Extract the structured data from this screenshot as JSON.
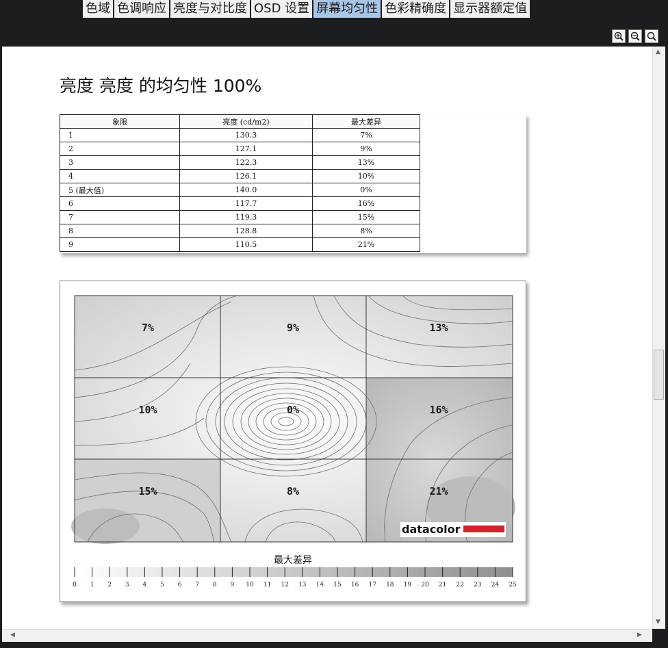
{
  "tabs": [
    {
      "label": "色域"
    },
    {
      "label": "色调响应"
    },
    {
      "label": "亮度与对比度"
    },
    {
      "label": "OSD 设置"
    },
    {
      "label": "屏幕均匀性",
      "active": true
    },
    {
      "label": "色彩精确度"
    },
    {
      "label": "显示器额定值"
    }
  ],
  "toolbar": {
    "zoom_in_icon": "zoom-in-icon",
    "zoom_out_icon": "zoom-out-icon",
    "zoom_fit_icon": "zoom-fit-icon"
  },
  "report": {
    "title": "亮度 亮度 的均匀性 100%",
    "table": {
      "headers": [
        "象限",
        "亮度 (cd/m2)",
        "最大差异"
      ],
      "rows": [
        [
          "1",
          "130.3",
          "7%"
        ],
        [
          "2",
          "127.1",
          "9%"
        ],
        [
          "3",
          "122.3",
          "13%"
        ],
        [
          "4",
          "126.1",
          "10%"
        ],
        [
          "5 (最大值)",
          "140.0",
          "0%"
        ],
        [
          "6",
          "117.7",
          "16%"
        ],
        [
          "7",
          "119.3",
          "15%"
        ],
        [
          "8",
          "128.8",
          "8%"
        ],
        [
          "9",
          "110.5",
          "21%"
        ]
      ]
    },
    "heatmap": {
      "cells": [
        "7%",
        "9%",
        "13%",
        "10%",
        "0%",
        "16%",
        "15%",
        "8%",
        "21%"
      ],
      "logo_text": "datacolor",
      "legend_title": "最大差异",
      "legend_ticks": [
        "0",
        "1",
        "2",
        "3",
        "4",
        "5",
        "6",
        "7",
        "8",
        "9",
        "10",
        "11",
        "12",
        "13",
        "14",
        "15",
        "16",
        "17",
        "18",
        "19",
        "20",
        "21",
        "22",
        "23",
        "24",
        "25"
      ]
    }
  },
  "colors": {
    "active_tab": "#a9c6e6",
    "logo_bar": "#d4202a",
    "window_bg": "#1c1d1f"
  }
}
